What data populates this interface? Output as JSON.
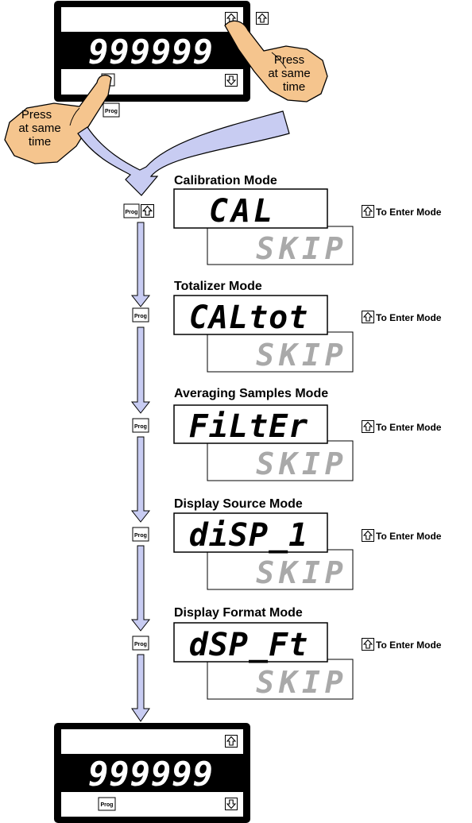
{
  "top_meter": {
    "display": "999999"
  },
  "bottom_meter": {
    "display": "999999"
  },
  "prog_label": "Prog",
  "press_left": [
    "Press",
    "at same",
    "time"
  ],
  "press_right": [
    "Press",
    "at same",
    "time"
  ],
  "enter_text": "To Enter Mode",
  "modes": [
    {
      "title": "Calibration Mode",
      "display": "CAL",
      "skip": "SKIP"
    },
    {
      "title": "Totalizer Mode",
      "display": "CALtot",
      "skip": "SKIP"
    },
    {
      "title": "Averaging Samples Mode",
      "display": "FiLtEr",
      "skip": "SKIP"
    },
    {
      "title": "Display Source Mode",
      "display": "diSP_1",
      "skip": "SKIP"
    },
    {
      "title": "Display Format Mode",
      "display": "dSP_Ft",
      "skip": "SKIP"
    }
  ],
  "colors": {
    "arrow_fill": "#c8ccf2",
    "hand_fill": "#f5c58e",
    "segment_off": "#a9a9a9"
  }
}
